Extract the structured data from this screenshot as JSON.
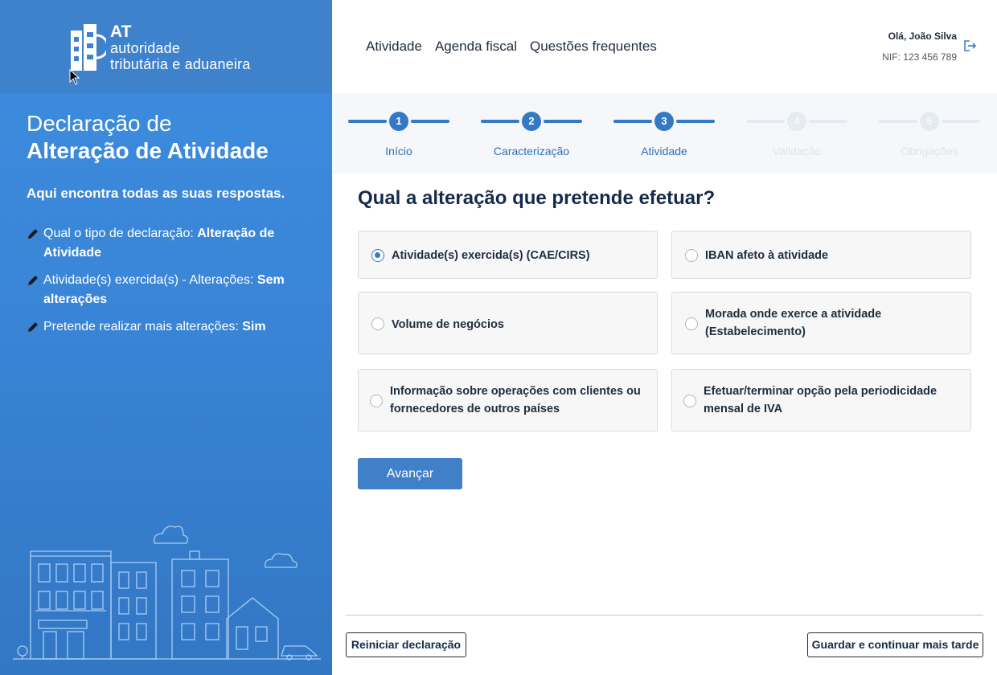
{
  "brand": {
    "short": "AT",
    "line1": "autoridade",
    "line2": "tributária e aduaneira"
  },
  "sidebar": {
    "title_line1": "Declaração de",
    "title_line2": "Alteração de Atividade",
    "answers_heading": "Aqui encontra todas as suas respostas.",
    "answers": [
      {
        "question": "Qual o tipo de declaração:",
        "answer": "Alteração de Atividade"
      },
      {
        "question": "Atividade(s) exercida(s) - Alterações:",
        "answer": "Sem alterações"
      },
      {
        "question": "Pretende realizar mais alterações:",
        "answer": "Sim"
      }
    ]
  },
  "nav": {
    "items": [
      "Atividade",
      "Agenda fiscal",
      "Questões frequentes"
    ]
  },
  "user": {
    "greeting": "Olá, João Silva",
    "nif": "NIF: 123 456 789"
  },
  "stepper": {
    "steps": [
      {
        "number": "1",
        "label": "Início",
        "state": "done"
      },
      {
        "number": "2",
        "label": "Caracterização",
        "state": "done"
      },
      {
        "number": "3",
        "label": "Atividade",
        "state": "current"
      },
      {
        "number": "4",
        "label": "Validação",
        "state": "todo"
      },
      {
        "number": "5",
        "label": "Obrigações",
        "state": "todo"
      }
    ]
  },
  "main": {
    "question": "Qual a alteração que pretende efetuar?",
    "options": [
      {
        "label": "Atividade(s) exercida(s) (CAE/CIRS)",
        "selected": true
      },
      {
        "label": "IBAN afeto à atividade",
        "selected": false
      },
      {
        "label": "Volume de negócios",
        "selected": false
      },
      {
        "label": "Morada onde exerce a atividade (Estabelecimento)",
        "selected": false
      },
      {
        "label": "Informação sobre operações com clientes ou fornecedores de outros países",
        "selected": false
      },
      {
        "label": "Efetuar/terminar opção pela periodicidade mensal de IVA",
        "selected": false
      }
    ],
    "next_button": "Avançar"
  },
  "footer": {
    "restart_button": "Reiniciar declaração",
    "save_button": "Guardar e continuar mais tarde"
  },
  "colors": {
    "primary": "#3479c4",
    "sidebar": "#3d8de0",
    "heading": "#152a4a"
  }
}
